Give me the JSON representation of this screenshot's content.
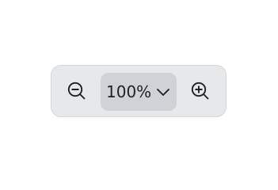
{
  "zoom": {
    "value_label": "100%",
    "zoom_out_icon": "zoom-out-icon",
    "zoom_in_icon": "zoom-in-icon",
    "dropdown_icon": "chevron-down-icon"
  },
  "colors": {
    "toolbar_bg": "#e6e8ea",
    "select_bg": "#cfd2d6",
    "icon": "#202226"
  }
}
